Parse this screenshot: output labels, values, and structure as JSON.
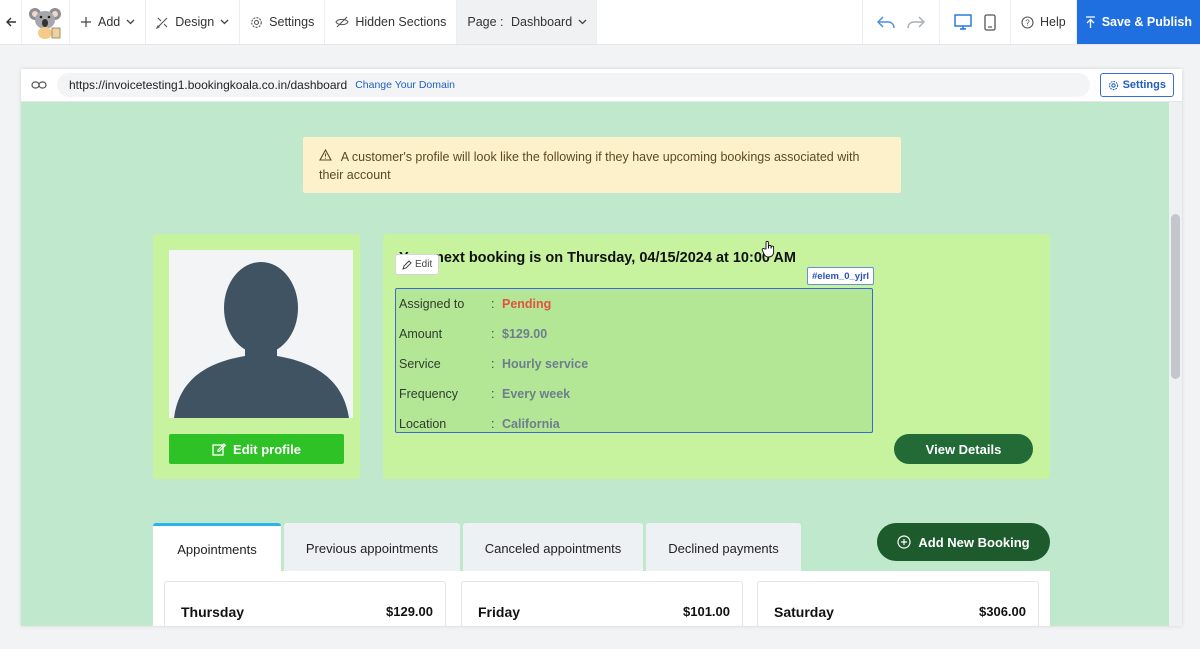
{
  "toolbar": {
    "add_label": "Add",
    "design_label": "Design",
    "settings_label": "Settings",
    "hidden_sections_label": "Hidden Sections",
    "page_prefix": "Page :",
    "page_value": "Dashboard",
    "help_label": "Help",
    "publish_label": "Save & Publish"
  },
  "urlbar": {
    "url": "https://invoicetesting1.bookingkoala.co.in/dashboard",
    "change_domain": "Change Your Domain",
    "settings_label": "Settings"
  },
  "notice": {
    "text": "A customer's profile will look like the following if they have upcoming bookings associated with their account"
  },
  "profile": {
    "edit_label": "Edit profile"
  },
  "booking": {
    "title": "Your next booking is on Thursday, 04/15/2024 at 10:00 AM",
    "edit_chip": "Edit",
    "elem_tag": "#elem_0_yjrl",
    "details": [
      {
        "label": "Assigned to",
        "value": "Pending"
      },
      {
        "label": "Amount",
        "value": "$129.00"
      },
      {
        "label": "Service",
        "value": "Hourly service"
      },
      {
        "label": "Frequency",
        "value": "Every week"
      },
      {
        "label": "Location",
        "value": "California"
      }
    ],
    "separator": ":",
    "view_details_label": "View Details"
  },
  "tabs": [
    {
      "label": "Appointments"
    },
    {
      "label": "Previous appointments"
    },
    {
      "label": "Canceled appointments"
    },
    {
      "label": "Declined payments"
    }
  ],
  "add_booking_label": "Add New Booking",
  "days": [
    {
      "day": "Thursday",
      "amount": "$129.00"
    },
    {
      "day": "Friday",
      "amount": "$101.00"
    },
    {
      "day": "Saturday",
      "amount": "$306.00"
    }
  ],
  "colors": {
    "canvas_bg": "#bfe8cc",
    "card_bg": "#c7f39e",
    "publish_blue": "#1f6fe0",
    "pending_red": "#e0543f",
    "view_details_green": "#226b36",
    "edit_profile_green": "#2ec227"
  }
}
